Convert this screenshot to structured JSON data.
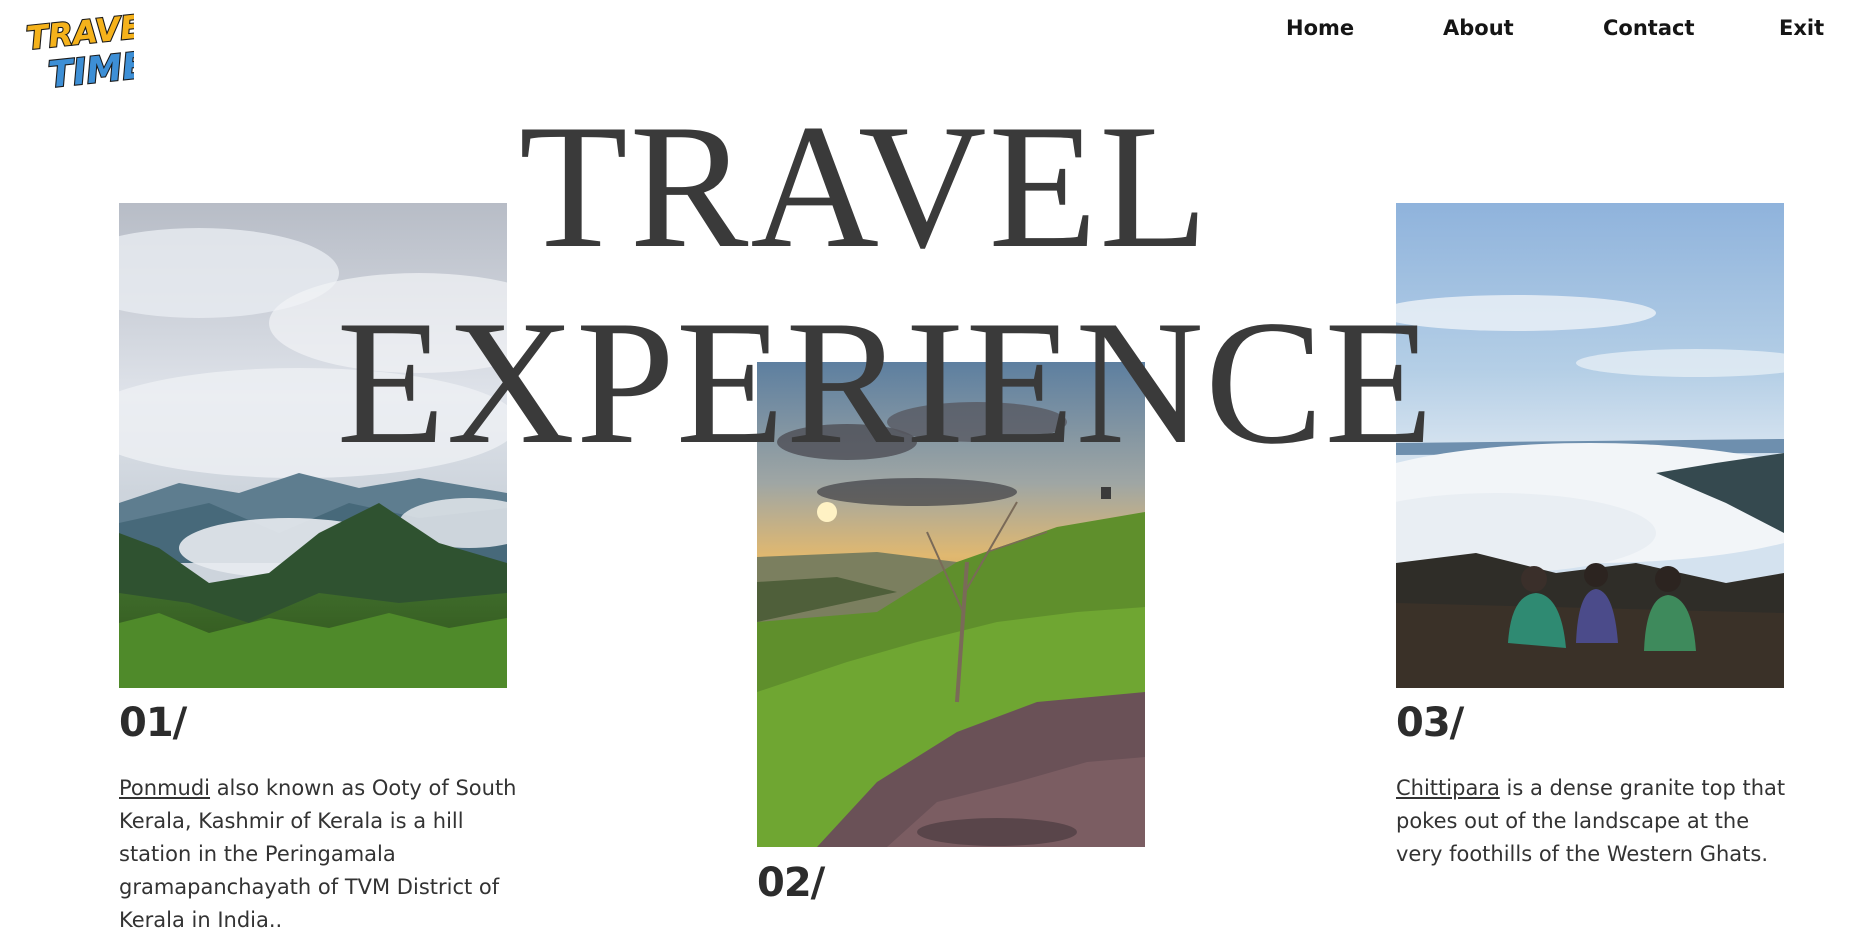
{
  "brand": {
    "logo_line1": "TRAVEL",
    "logo_line2": "TIME!"
  },
  "nav": {
    "home": "Home",
    "about": "About",
    "contact": "Contact",
    "exit": "Exit"
  },
  "hero": {
    "line1": "TRAVEL",
    "line2": "EXPERIENCE"
  },
  "cards": [
    {
      "number": "01/",
      "link": "Ponmudi",
      "text": " also known as Ooty of South Kerala, Kashmir of Kerala is a hill station in the Peringamala gramapanchayath of TVM District of Kerala in India.."
    },
    {
      "number": "02/"
    },
    {
      "number": "03/",
      "link": "Chittipara",
      "text": " is a dense granite top that pokes out of the landscape at the very foothills of the Western Ghats."
    }
  ],
  "colors": {
    "logo_yellow": "#f5b21b",
    "logo_blue": "#3d8fd6",
    "text": "#2b2b2b"
  }
}
